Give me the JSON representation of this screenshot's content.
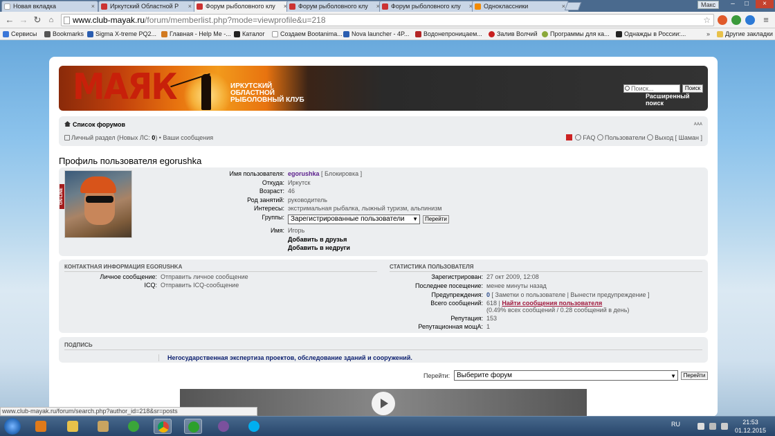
{
  "browser": {
    "tabs": [
      {
        "label": "Новая вкладка",
        "close": "×"
      },
      {
        "label": "Иркутский Областной Р",
        "close": "×"
      },
      {
        "label": "Форум рыболовного клу",
        "close": "×"
      },
      {
        "label": "Форум рыболовного клу",
        "close": "×"
      },
      {
        "label": "Форум рыболовного клу",
        "close": "×"
      },
      {
        "label": "Одноклассники",
        "close": "×"
      }
    ],
    "user_label": "Макс",
    "window_buttons": {
      "minimize": "–",
      "maximize": "□",
      "close": "×"
    },
    "url_host": "www.club-mayak.ru",
    "url_path": "/forum/memberlist.php?mode=viewprofile&u=218",
    "nav": {
      "back": "←",
      "forward": "→",
      "reload": "↻",
      "star": "☆"
    },
    "bookmarks": [
      "Сервисы",
      "Bookmarks",
      "Sigma X-treme PQ2...",
      "Главная - Help Me -...",
      "Каталог",
      "Создаем Bootanima...",
      "Nova launcher - 4P...",
      "Водонепроницаем...",
      "Залив Волчий",
      "Программы для ка...",
      "Однажды в России:..."
    ],
    "other_bookmarks": "Другие закладки",
    "more_bookmarks": "»",
    "status_url": "www.club-mayak.ru/forum/search.php?author_id=218&sr=posts"
  },
  "site": {
    "logo": "МАЯК",
    "club_name": "ИРКУТСКИЙ ОБЛАСТНОЙ РЫБОЛОВНЫЙ КЛУБ",
    "search_placeholder": "Поиск...",
    "search_button": "Поиск",
    "advanced_search": "Расширенный поиск"
  },
  "navbar": {
    "forum_list": "Список форумов",
    "font_size": "ᴬᴬᴬ",
    "personal": "Личный раздел (Новых ЛС: ",
    "personal_count": "0",
    "personal_end": ") • ",
    "my_messages": "Ваши сообщения",
    "faq": "FAQ",
    "users": "Пользователи",
    "logout": "Выход [ Шаман ]"
  },
  "profile": {
    "title": "Профиль пользователя egorushka",
    "online_badge": "ON-LINE",
    "fields": {
      "username_label": "Имя пользователя:",
      "username": "egorushka",
      "ban": "[ Блокировка ]",
      "from_label": "Откуда:",
      "from": "Иркутск",
      "age_label": "Возраст:",
      "age": "46",
      "occupation_label": "Род занятий:",
      "occupation": "руководитель",
      "interests_label": "Интересы:",
      "interests": "экстримальная рыбалка, лыжный туризм, альпинизм",
      "groups_label": "Группы:",
      "groups_selected": "Зарегистрированные пользователи",
      "groups_go": "Перейти",
      "name_label": "Имя:",
      "name": "Игорь",
      "add_friend": "Добавить в друзья",
      "add_foe": "Добавить в недруги"
    }
  },
  "contacts": {
    "header": "Контактная информация egorushka",
    "pm_label": "Личное сообщение:",
    "pm_value": "Отправить личное сообщение",
    "icq_label": "ICQ:",
    "icq_value": "Отправить ICQ-сообщение"
  },
  "stats": {
    "header": "Статистика пользователя",
    "registered_label": "Зарегистрирован:",
    "registered": "27 окт 2009, 12:08",
    "last_visit_label": "Последнее посещение:",
    "last_visit": "менее минуты назад",
    "warnings_label": "Предупреждения:",
    "warnings_count": "0",
    "warnings_actions": "[ Заметки о пользователе | Вынести предупреждение ]",
    "posts_label": "Всего сообщений:",
    "posts_count": "618 |",
    "posts_link": "Найти сообщения пользователя",
    "posts_share": "(0.49% всех сообщений / 0.28 сообщений в день)",
    "reputation_label": "Репутация:",
    "reputation": "153",
    "rep_power_label": "Репутационная мощА:",
    "rep_power": "1"
  },
  "signature": {
    "header": "Подпись",
    "text": "Негосударственная экспертиза проектов, обследование зданий и сооружений."
  },
  "jump": {
    "label": "Перейти:",
    "selected": "Выберите форум",
    "button": "Перейти"
  },
  "taskbar": {
    "lang": "RU",
    "time": "21:53",
    "date": "01.12.2015"
  }
}
